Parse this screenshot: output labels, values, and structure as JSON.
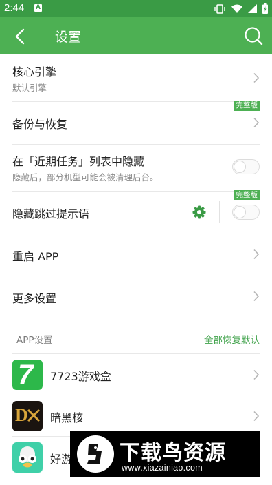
{
  "status_bar": {
    "time": "2:44",
    "notification_letter": "A"
  },
  "app_bar": {
    "title": "设置"
  },
  "settings": [
    {
      "title": "核心引擎",
      "subtitle": "默认引擎"
    },
    {
      "title": "备份与恢复",
      "badge": "完整版"
    },
    {
      "title": "在「近期任务」列表中隐藏",
      "subtitle": "隐藏后，部分机型可能会被清理后台。",
      "toggle_on": false
    },
    {
      "title": "隐藏跳过提示语",
      "badge": "完整版",
      "toggle_on": false
    },
    {
      "title": "重启 APP"
    },
    {
      "title": "更多设置"
    }
  ],
  "app_section": {
    "header": "APP设置",
    "action": "全部恢复默认",
    "apps": [
      {
        "name": "7723游戏盒",
        "icon_text": "7"
      },
      {
        "name": "暗黑核",
        "icon_text": "D"
      },
      {
        "name": "好游"
      }
    ]
  },
  "watermark": {
    "title": "下载鸟资源",
    "url": "www.xiazainiao.com"
  },
  "colors": {
    "status_bar": "#3a9b45",
    "app_bar": "#4db053",
    "accent": "#3fa24a"
  }
}
